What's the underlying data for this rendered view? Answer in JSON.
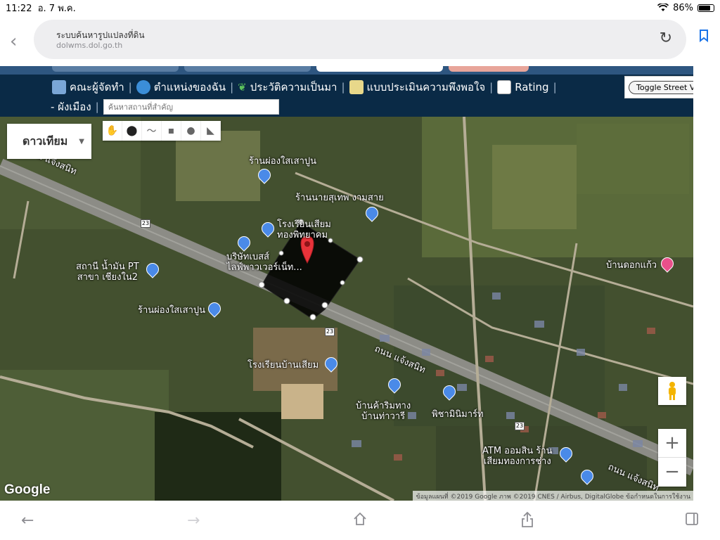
{
  "status_bar": {
    "time": "11:22",
    "date": "อ. 7 พ.ค.",
    "battery": "86%"
  },
  "address_bar": {
    "title": "ระบบค้นหารูปแปลงที่ดิน",
    "url": "dolwms.dol.go.th"
  },
  "nav": {
    "items": [
      {
        "label": "คณะผู้จัดทำ",
        "icon": "team-icon"
      },
      {
        "label": "ตำแหน่งของฉัน",
        "icon": "globe-icon"
      },
      {
        "label": "ประวัติความเป็นมา",
        "icon": "plant-icon"
      },
      {
        "label": "แบบประเมินความพึงพอใจ",
        "icon": "pencil-icon"
      },
      {
        "label": "Rating",
        "icon": "chart-icon"
      }
    ],
    "zoning_label": "- ผังเมือง",
    "search_placeholder": "ค้นหาสถานที่สำคัญ",
    "street_view_label": "Toggle Street View"
  },
  "map": {
    "map_type": "ดาวเทียม",
    "labels": {
      "road1": "ถนน แจ้งสนิท",
      "shop1": "ร้านผ่องใสเสาปูน",
      "shop2": "ร้านนายสุเทพ งามสาย",
      "school1a": "โรงเรียนเสียม",
      "school1b": "ทองพิทยาคม",
      "company_a": "บริษัทเบสส์",
      "company_b": "ไลฟ์พาวเวอร์เน็ท...",
      "gas_a": "สถานี น้ำมัน PT",
      "gas_b": "สาขา เชียงใน2",
      "shop3": "ร้านผ่องใสเสาปูน",
      "flower": "บ้านดอกแก้ว",
      "school2": "โรงเรียนบ้านเสียม",
      "road2": "ถนน แจ้งสนิท",
      "roadside_a": "บ้านค้าริมทาง",
      "roadside_b": "บ้านท่าวารี",
      "mart": "พิชามินิมาร์ท",
      "atm_a": "ATM ออมสิน ร้าน",
      "atm_b": "เสียมทองการช่าง",
      "road3": "ถนน แจ้งสนิท",
      "route": "23"
    },
    "google": "Google",
    "attribution": "ข้อมูลแผนที่ ©2019 Google ภาพ ©2019 CNES / Airbus, DigitalGlobe   ข้อกำหนดในการใช้งาน",
    "zoom_in": "+",
    "zoom_out": "−"
  },
  "colors": {
    "navbar": "#0a2a46",
    "parcel": "#000000",
    "pin": "#e8333a"
  }
}
